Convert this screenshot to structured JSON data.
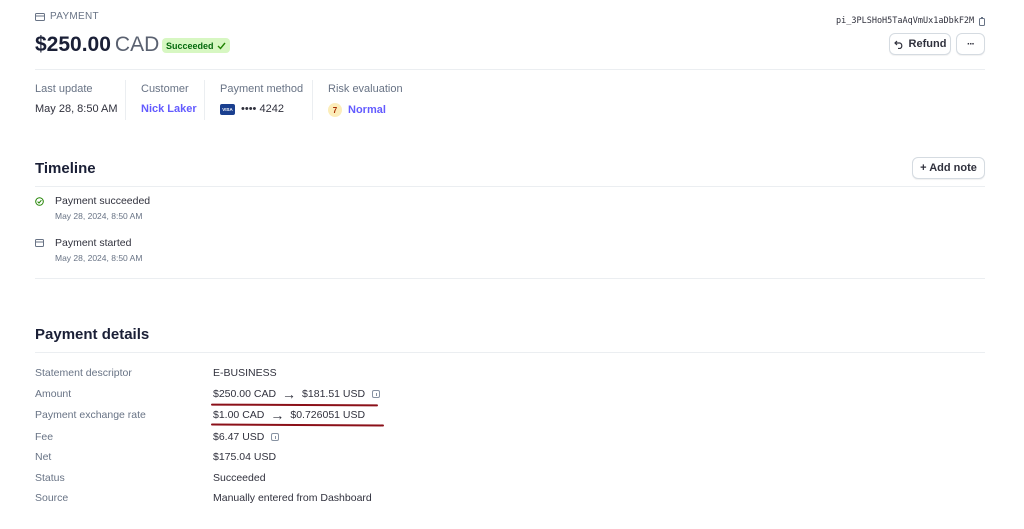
{
  "header": {
    "section_label": "PAYMENT",
    "payment_id": "pi_3PLSHoH5TaAqVmUx1aDbkF2M",
    "amount": "$250.00",
    "currency": "CAD",
    "status_badge": "Succeeded",
    "refund_label": "Refund",
    "more_label": "···"
  },
  "summary": {
    "last_update_label": "Last update",
    "last_update_value": "May 28, 8:50 AM",
    "customer_label": "Customer",
    "customer_value": "Nick Laker",
    "payment_method_label": "Payment method",
    "card_brand": "VISA",
    "card_last4": "•••• 4242",
    "risk_label": "Risk evaluation",
    "risk_score": "7",
    "risk_value": "Normal"
  },
  "timeline": {
    "title": "Timeline",
    "add_note_label": "+ Add note",
    "events": [
      {
        "title": "Payment succeeded",
        "time": "May 28, 2024, 8:50 AM"
      },
      {
        "title": "Payment started",
        "time": "May 28, 2024, 8:50 AM"
      }
    ]
  },
  "details": {
    "title": "Payment details",
    "rows": [
      {
        "key": "Statement descriptor",
        "value": "E-BUSINESS"
      },
      {
        "key": "Amount",
        "value_from": "$250.00 CAD",
        "value_to": "$181.51 USD"
      },
      {
        "key": "Payment exchange rate",
        "value_from": "$1.00 CAD",
        "value_to": "$0.726051 USD"
      },
      {
        "key": "Fee",
        "value": "$6.47 USD"
      },
      {
        "key": "Net",
        "value": "$175.04 USD"
      },
      {
        "key": "Status",
        "value": "Succeeded"
      },
      {
        "key": "Source",
        "value": "Manually entered from Dashboard"
      }
    ]
  },
  "colors": {
    "accent": "#635bff",
    "success": "#228403",
    "success_bg": "#d7f7c2",
    "annotation": "#8b1019"
  }
}
